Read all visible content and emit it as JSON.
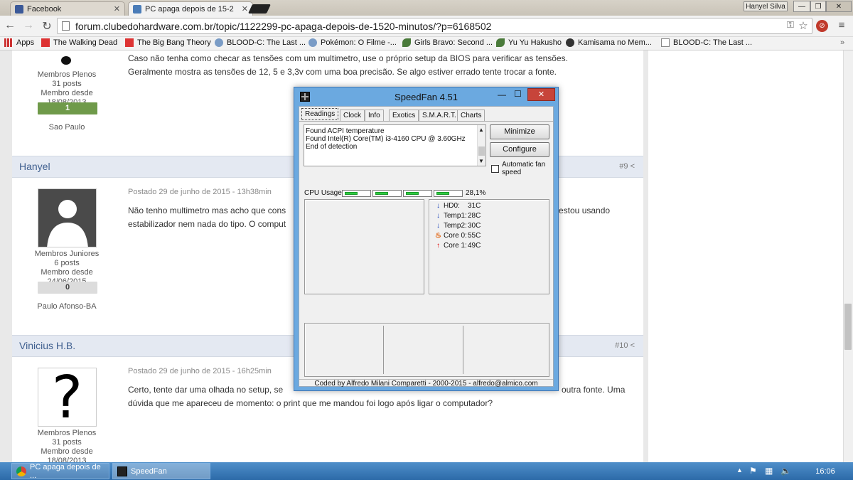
{
  "browser": {
    "tabs": [
      {
        "label": "Facebook",
        "icon": "facebook-icon"
      },
      {
        "label": "PC apaga depois de 15-2",
        "icon": "forum-icon"
      }
    ],
    "user_button": "Hanyel Silva",
    "url": "forum.clubedohardware.com.br/topic/1122299-pc-apaga-depois-de-1520-minutos/?p=6168502",
    "bookmarks": [
      {
        "label": "Apps",
        "icon": "apps-icon"
      },
      {
        "label": "The Walking Dead",
        "icon": "bookmark-b-icon"
      },
      {
        "label": "The Big Bang Theory",
        "icon": "bookmark-b-icon"
      },
      {
        "label": "BLOOD-C: The Last ...",
        "icon": "bookmark-site-icon"
      },
      {
        "label": "Pokémon: O Filme -...",
        "icon": "bookmark-site-icon"
      },
      {
        "label": "Girls Bravo: Second ...",
        "icon": "bookmark-leaf-icon"
      },
      {
        "label": "Yu Yu Hakusho",
        "icon": "bookmark-leaf-icon"
      },
      {
        "label": "Kamisama no Mem...",
        "icon": "bookmark-circle-icon"
      },
      {
        "label": "BLOOD-C: The Last ...",
        "icon": "bookmark-page-icon"
      }
    ]
  },
  "forum": {
    "prev_post": {
      "role": "Membros Plenos",
      "posts": "31 posts",
      "since": "Membro desde 18/08/2013",
      "reputation": "1",
      "location": "Sao Paulo",
      "text_lines": [
        "Caso não tenha como checar as tensões com um multimetro, use o próprio setup da BIOS para verificar as tensões.",
        "Geralmente mostra as tensões de 12, 5 e 3,3v com uma boa precisão. Se algo estiver errado tente trocar a fonte."
      ]
    },
    "post9": {
      "author": "Hanyel",
      "number": "#9",
      "date": "Postado 29 de junho de 2015 - 13h38min",
      "role": "Membros Juniores",
      "posts": "6 posts",
      "since": "Membro desde 24/06/2015",
      "reputation": "0",
      "location": "Paulo Afonso-BA",
      "text_left": [
        "Não tenho multimetro mas acho que cons",
        "estabilizador nem nada do tipo. O comput"
      ],
      "text_right": [
        "estou usando"
      ]
    },
    "post10": {
      "author": "Vinicius H.B.",
      "number": "#10",
      "date": "Postado 29 de junho de 2015 - 16h25min",
      "role": "Membros Plenos",
      "posts": "31 posts",
      "since": "Membro desde 18/08/2013",
      "avatar_glyph": "?",
      "text_left": [
        "Certo, tente dar uma olhada no setup, se",
        "dúvida que me apareceu de momento: o print que me mandou foi logo após ligar o computador?"
      ],
      "text_right": [
        "outra fonte. Uma"
      ]
    },
    "colors": {
      "rep_positive": "#6f9a4a",
      "rep_neutral": "#dcdcdc",
      "header_bg": "#e4e9f2",
      "author": "#3f5f8f"
    }
  },
  "speedfan": {
    "title": "SpeedFan 4.51",
    "tabs": [
      "Readings",
      "Clock",
      "Info",
      "Exotics",
      "S.M.A.R.T.",
      "Charts"
    ],
    "log": [
      "Found ACPI temperature",
      "Found Intel(R) Core(TM) i3-4160 CPU @ 3.60GHz",
      "End of detection"
    ],
    "minimize_button": "Minimize",
    "configure_button": "Configure",
    "auto_fan_label_1": "Automatic fan",
    "auto_fan_label_2": "speed",
    "cpu_usage_label": "CPU Usage",
    "cpu_usage_value": "28,1%",
    "cpu_cores": 4,
    "readings": [
      {
        "label": "HD0:",
        "value": "31C",
        "trend": "down"
      },
      {
        "label": "Temp1:",
        "value": "28C",
        "trend": "down"
      },
      {
        "label": "Temp2:",
        "value": "30C",
        "trend": "down"
      },
      {
        "label": "Core 0:",
        "value": "55C",
        "trend": "hot"
      },
      {
        "label": "Core 1:",
        "value": "49C",
        "trend": "up"
      }
    ],
    "footer": "Coded by Alfredo Milani Comparetti - 2000-2015 - alfredo@almico.com"
  },
  "taskbar": {
    "items": [
      {
        "label": "PC apaga depois de ...",
        "icon": "chrome-icon"
      },
      {
        "label": "SpeedFan",
        "icon": "speedfan-icon"
      }
    ],
    "time": "16:06"
  }
}
